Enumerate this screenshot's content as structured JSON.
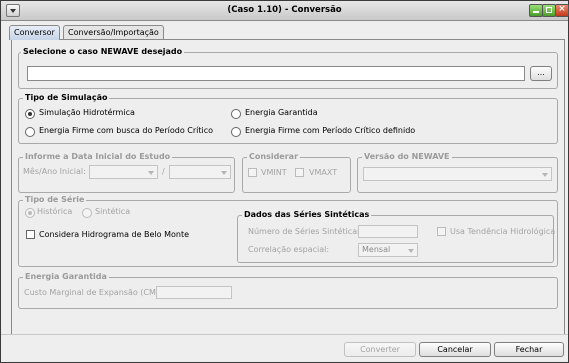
{
  "window": {
    "title": "(Caso 1.10) - Conversão"
  },
  "tabs": [
    {
      "label": "Conversor",
      "active": true
    },
    {
      "label": "Conversão/Importação",
      "active": false
    }
  ],
  "case_group": {
    "legend": "Selecione o caso NEWAVE desejado",
    "path_value": "",
    "browse_label": "..."
  },
  "sim_type": {
    "legend": "Tipo de Simulação",
    "options": [
      {
        "label": "Simulação Hidrotérmica",
        "selected": true
      },
      {
        "label": "Energia Garantida",
        "selected": false
      },
      {
        "label": "Energia Firme com busca do Período Crítico",
        "selected": false
      },
      {
        "label": "Energia Firme com Período Crítico definido",
        "selected": false
      }
    ]
  },
  "start_date": {
    "legend": "Informe a Data Inicial do Estudo",
    "label": "Mês/Ano Inicial:",
    "separator": "/"
  },
  "consider": {
    "legend": "Considerar",
    "vmint": "VMINT",
    "vmaxt": "VMAXT"
  },
  "newave_version": {
    "legend": "Versão do NEWAVE"
  },
  "series_type": {
    "legend": "Tipo de Série",
    "historica": "Histórica",
    "sintetica": "Sintética",
    "belo_monte": "Considera Hidrograma de Belo Monte"
  },
  "synthetic": {
    "legend": "Dados das Séries Sintéticas",
    "num_series_label": "Número de Séries Sintéticas:",
    "trend_label": "Usa Tendência Hidrológica",
    "correlation_label": "Correlação espacial:",
    "correlation_value": "Mensal"
  },
  "guaranteed_energy": {
    "legend": "Energia Garantida",
    "cme_label": "Custo Marginal de Expansão (CME):"
  },
  "buttons": {
    "convert": "Converter",
    "cancel": "Cancelar",
    "close": "Fechar"
  }
}
